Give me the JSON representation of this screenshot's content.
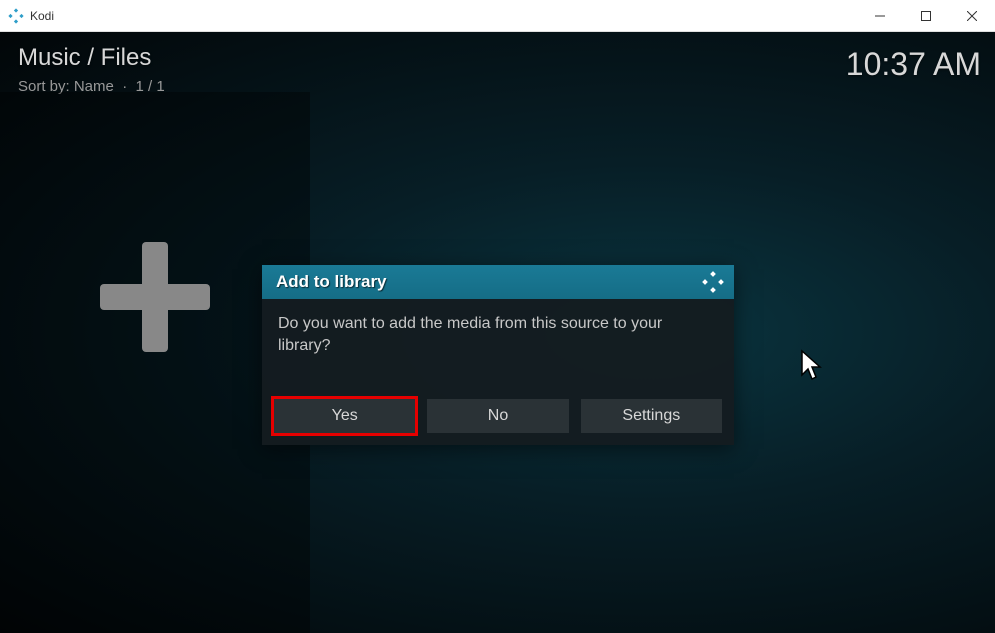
{
  "window": {
    "title": "Kodi"
  },
  "header": {
    "breadcrumb": "Music / Files",
    "sort_label": "Sort by: Name",
    "page_info": "1 / 1",
    "clock": "10:37 AM"
  },
  "dialog": {
    "title": "Add to library",
    "message": "Do you want to add the media from this source to your library?",
    "buttons": {
      "yes": "Yes",
      "no": "No",
      "settings": "Settings"
    }
  },
  "icons": {
    "kodi": "kodi-logo",
    "add": "plus"
  }
}
